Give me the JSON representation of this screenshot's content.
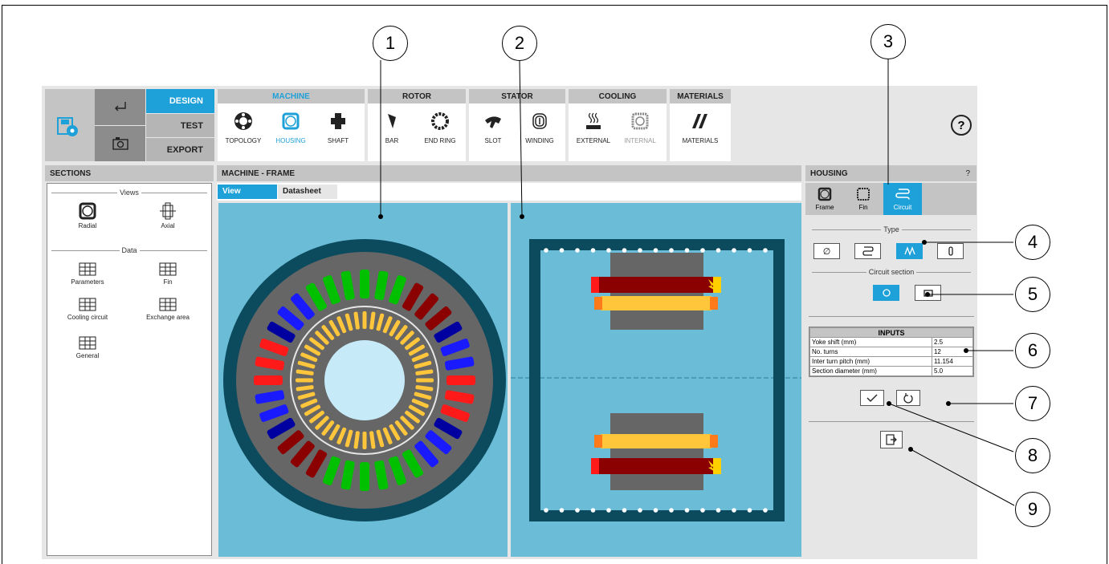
{
  "menu": {
    "design": "DESIGN",
    "test": "TEST",
    "export": "EXPORT"
  },
  "ribbon": {
    "machine": {
      "title": "MACHINE",
      "tools": [
        "TOPOLOGY",
        "HOUSING",
        "SHAFT"
      ]
    },
    "rotor": {
      "title": "ROTOR",
      "tools": [
        "BAR",
        "END RING"
      ]
    },
    "stator": {
      "title": "STATOR",
      "tools": [
        "SLOT",
        "WINDING"
      ]
    },
    "cooling": {
      "title": "COOLING",
      "tools": [
        "EXTERNAL",
        "INTERNAL"
      ]
    },
    "materials": {
      "title": "MATERIALS",
      "tools": [
        "MATERIALS"
      ]
    },
    "help": "?"
  },
  "sections": {
    "title": "SECTIONS",
    "views_label": "Views",
    "data_label": "Data",
    "views": [
      "Radial",
      "Axial"
    ],
    "data": [
      "Parameters",
      "Fin",
      "Cooling circuit",
      "Exchange area",
      "General"
    ]
  },
  "main": {
    "title": "MACHINE - FRAME",
    "tabs": [
      "View",
      "Datasheet"
    ]
  },
  "housing": {
    "title": "HOUSING",
    "help": "?",
    "tabs": [
      "Frame",
      "Fin",
      "Circuit"
    ],
    "type_label": "Type",
    "circuit_section_label": "Circuit section",
    "inputs_title": "INPUTS",
    "inputs": [
      {
        "label": "Yoke shift (mm)",
        "value": "2.5"
      },
      {
        "label": "No. turns",
        "value": "12"
      },
      {
        "label": "Inter turn pitch (mm)",
        "value": "11.154"
      },
      {
        "label": "Section diameter (mm)",
        "value": "5.0"
      }
    ]
  },
  "callouts": [
    "1",
    "2",
    "3",
    "4",
    "5",
    "6",
    "7",
    "8",
    "9"
  ],
  "colors": {
    "accent": "#1ea0d8",
    "view_bg": "#6bbcd6",
    "housing": "#0c4a5e"
  }
}
